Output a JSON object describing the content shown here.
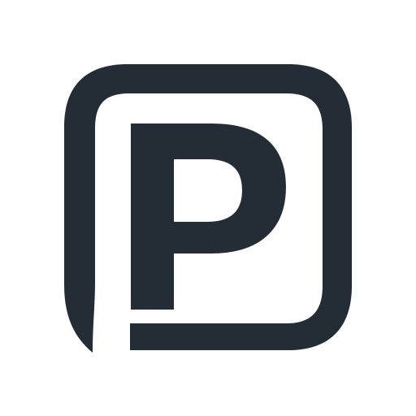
{
  "logo": {
    "icon": "parking-p-icon",
    "color": "#242d35",
    "background": "#ffffff",
    "lettering": "P"
  }
}
